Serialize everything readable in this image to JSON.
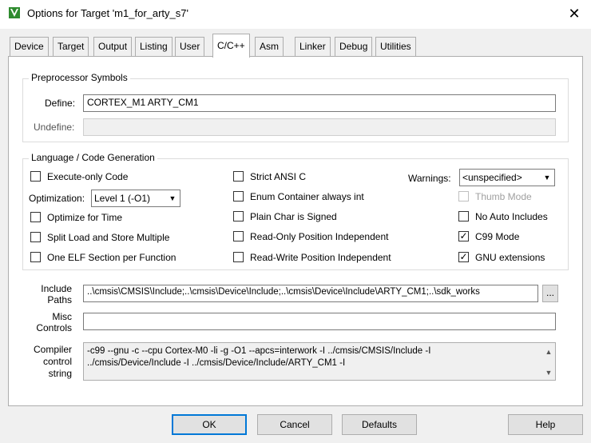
{
  "window": {
    "title": "Options for Target 'm1_for_arty_s7'",
    "close_glyph": "✕"
  },
  "tabs": [
    {
      "label": "Device"
    },
    {
      "label": "Target"
    },
    {
      "label": "Output"
    },
    {
      "label": "Listing"
    },
    {
      "label": "User"
    },
    {
      "label": "C/C++",
      "active": true
    },
    {
      "label": "Asm"
    },
    {
      "label": "Linker"
    },
    {
      "label": "Debug"
    },
    {
      "label": "Utilities"
    }
  ],
  "preprocessor": {
    "group_title": "Preprocessor Symbols",
    "define_label": "Define:",
    "define_value": "CORTEX_M1 ARTY_CM1",
    "undefine_label": "Undefine:",
    "undefine_value": ""
  },
  "language": {
    "group_title": "Language / Code Generation",
    "execute_only": {
      "label": "Execute-only Code",
      "checked": false
    },
    "optimization_label": "Optimization:",
    "optimization_value": "Level 1 (-O1)",
    "optimize_time": {
      "label": "Optimize for Time",
      "checked": false
    },
    "split_load": {
      "label": "Split Load and Store Multiple",
      "checked": false
    },
    "one_elf": {
      "label": "One ELF Section per Function",
      "checked": false
    },
    "strict_ansi": {
      "label": "Strict ANSI C",
      "checked": false
    },
    "enum_container": {
      "label": "Enum Container always int",
      "checked": false
    },
    "plain_char": {
      "label": "Plain Char is Signed",
      "checked": false
    },
    "ro_pi": {
      "label": "Read-Only Position Independent",
      "checked": false
    },
    "rw_pi": {
      "label": "Read-Write Position Independent",
      "checked": false
    },
    "warnings_label": "Warnings:",
    "warnings_value": "<unspecified>",
    "thumb_mode": {
      "label": "Thumb Mode",
      "checked": false,
      "disabled": true
    },
    "no_auto_includes": {
      "label": "No Auto Includes",
      "checked": false
    },
    "c99_mode": {
      "label": "C99 Mode",
      "checked": true
    },
    "gnu_extensions": {
      "label": "GNU extensions",
      "checked": true
    }
  },
  "include": {
    "label_line1": "Include",
    "label_line2": "Paths",
    "value": "..\\cmsis\\CMSIS\\Include;..\\cmsis\\Device\\Include;..\\cmsis\\Device\\Include\\ARTY_CM1;..\\sdk_works",
    "browse_label": "..."
  },
  "misc": {
    "label_line1": "Misc",
    "label_line2": "Controls",
    "value": ""
  },
  "compiler": {
    "label_line1": "Compiler",
    "label_line2": "control",
    "label_line3": "string",
    "line1": "-c99 --gnu -c --cpu Cortex-M0 -li -g -O1 --apcs=interwork -I ../cmsis/CMSIS/Include -I",
    "line2": "../cmsis/Device/Include -I ../cmsis/Device/Include/ARTY_CM1 -I"
  },
  "buttons": {
    "ok": "OK",
    "cancel": "Cancel",
    "defaults": "Defaults",
    "help": "Help"
  },
  "colors": {
    "dialog_bg": "#f0f0f0",
    "panel_bg": "#ffffff",
    "focus_blue": "#0078d7",
    "icon_green": "#2e8b2e"
  }
}
